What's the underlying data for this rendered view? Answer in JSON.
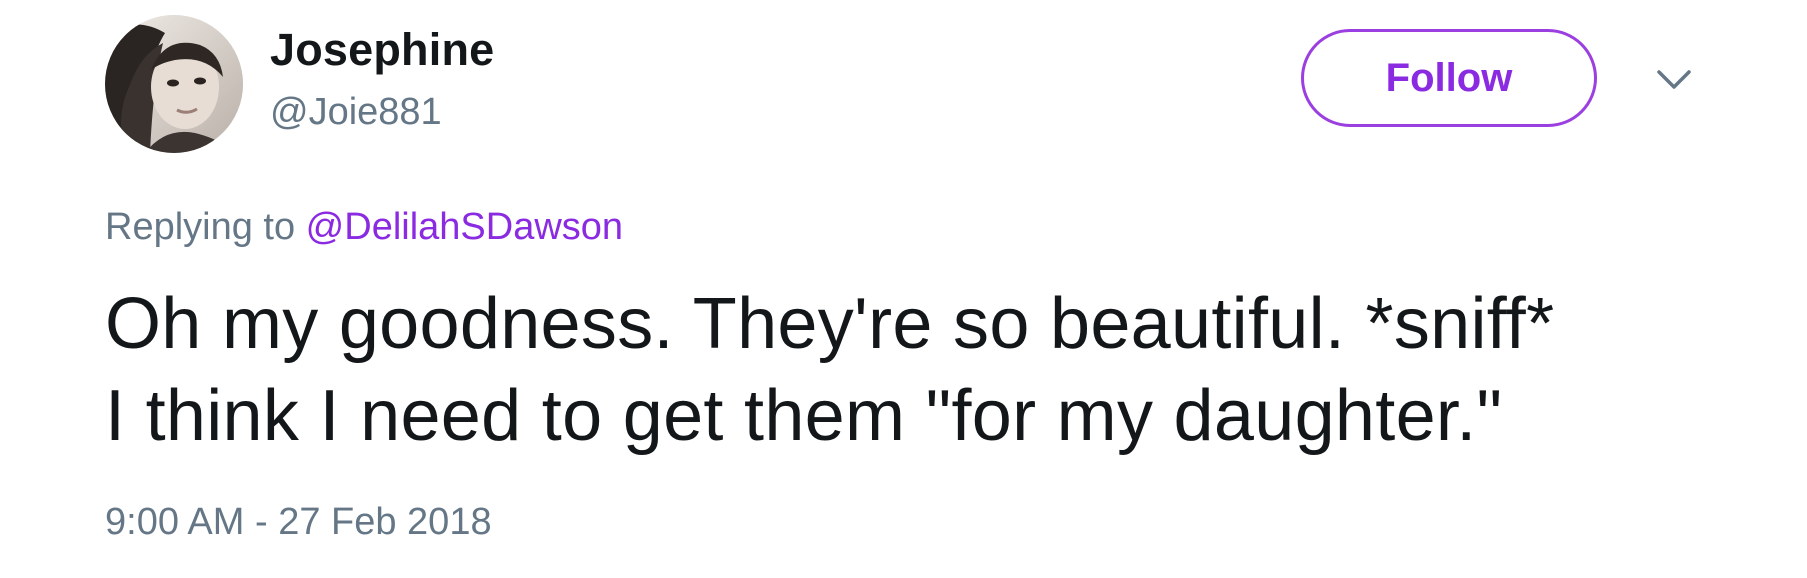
{
  "author": {
    "display_name": "Josephine",
    "handle": "@Joie881"
  },
  "follow_button": {
    "label": "Follow"
  },
  "reply": {
    "prefix": "Replying to ",
    "target": "@DelilahSDawson"
  },
  "tweet": {
    "lines": [
      "Oh my goodness. They're so beautiful. *sniff*",
      "I think I need to get them \"for my daughter.\""
    ]
  },
  "timestamp": "9:00 AM - 27 Feb 2018",
  "icons": {
    "avatar": "profile-photo",
    "menu": "chevron-down-icon"
  },
  "colors": {
    "accent": "#8a2be2",
    "text": "#14171a",
    "secondary_text": "#657786"
  }
}
